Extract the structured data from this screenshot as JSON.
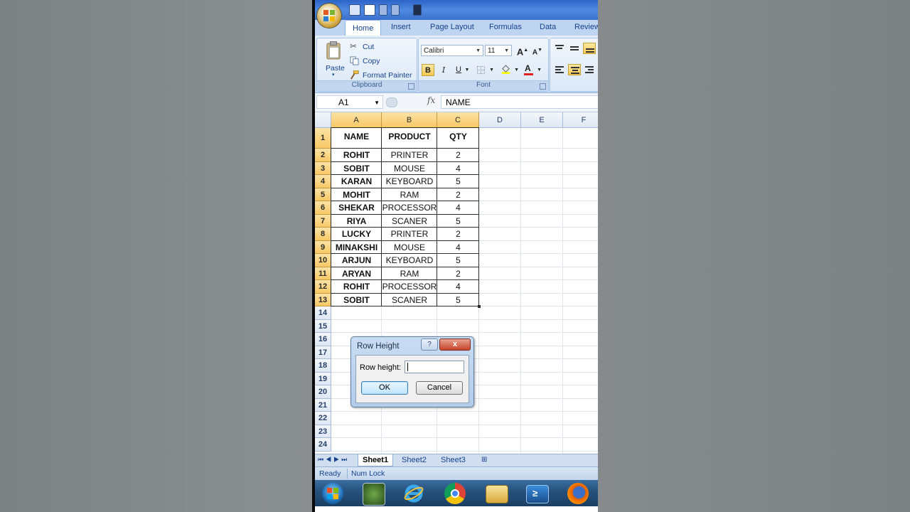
{
  "ribbon": {
    "tabs": [
      "Home",
      "Insert",
      "Page Layout",
      "Formulas",
      "Data",
      "Review"
    ],
    "active_tab": "Home",
    "clipboard": {
      "paste_label": "Paste",
      "cut_label": "Cut",
      "copy_label": "Copy",
      "format_painter_label": "Format Painter",
      "group_label": "Clipboard"
    },
    "font": {
      "font_name": "Calibri",
      "font_size": "11",
      "bold": "B",
      "italic": "I",
      "underline": "U",
      "grow_font": "A",
      "font_color_glyph": "A",
      "group_label": "Font"
    }
  },
  "formula_bar": {
    "name_box": "A1",
    "fx_label": "fx",
    "content": "NAME"
  },
  "sheet": {
    "columns": [
      "A",
      "B",
      "C",
      "D",
      "E",
      "F"
    ],
    "row_numbers": [
      "1",
      "2",
      "3",
      "4",
      "5",
      "6",
      "7",
      "8",
      "9",
      "10",
      "11",
      "12",
      "13",
      "14",
      "15",
      "16",
      "17",
      "18",
      "19",
      "20",
      "21",
      "22",
      "23",
      "24"
    ],
    "headers": [
      "NAME",
      "PRODUCT",
      "QTY"
    ],
    "rows": [
      [
        "ROHIT",
        "PRINTER",
        "2"
      ],
      [
        "SOBIT",
        "MOUSE",
        "4"
      ],
      [
        "KARAN",
        "KEYBOARD",
        "5"
      ],
      [
        "MOHIT",
        "RAM",
        "2"
      ],
      [
        "SHEKAR",
        "PROCESSOR",
        "4"
      ],
      [
        "RIYA",
        "SCANER",
        "5"
      ],
      [
        "LUCKY",
        "PRINTER",
        "2"
      ],
      [
        "MINAKSHI",
        "MOUSE",
        "4"
      ],
      [
        "ARJUN",
        "KEYBOARD",
        "5"
      ],
      [
        "ARYAN",
        "RAM",
        "2"
      ],
      [
        "ROHIT",
        "PROCESSOR",
        "4"
      ],
      [
        "SOBIT",
        "SCANER",
        "5"
      ]
    ]
  },
  "sheet_tabs": [
    "Sheet1",
    "Sheet2",
    "Sheet3"
  ],
  "active_sheet": "Sheet1",
  "status": {
    "ready": "Ready",
    "num_lock": "Num Lock"
  },
  "dialog": {
    "title": "Row Height",
    "help": "?",
    "close": "x",
    "label": "Row height:",
    "value": "",
    "ok_label": "OK",
    "cancel_label": "Cancel"
  },
  "taskbar": {
    "icons": [
      "start-orb-icon",
      "media-center-icon",
      "internet-explorer-icon",
      "chrome-icon",
      "file-explorer-icon",
      "powershell-icon",
      "firefox-icon"
    ]
  },
  "colors": {
    "ribbon_blue": "#bfd4f0",
    "selected_header": "#f8c865",
    "taskbar": "#25507b",
    "dialog_close": "#c6452d"
  }
}
